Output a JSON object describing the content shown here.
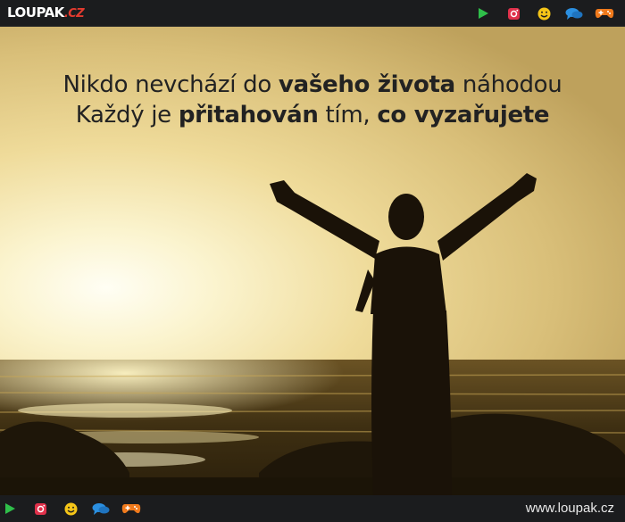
{
  "header": {
    "logo": {
      "main": "LOUPAK",
      "suffix": ".CZ"
    }
  },
  "nav_icons": [
    {
      "name": "play-icon",
      "color": "#2fbf4a"
    },
    {
      "name": "instagram-icon",
      "color": "#e0314b"
    },
    {
      "name": "smiley-icon",
      "color": "#f5c518"
    },
    {
      "name": "chat-icon",
      "color": "#2b8fe0"
    },
    {
      "name": "gamepad-icon",
      "color": "#f07a1c"
    }
  ],
  "quote": {
    "line1": {
      "a": "Nikdo nevchází do ",
      "b": "vašeho života",
      "c": " náhodou"
    },
    "line2": {
      "a": "Každý je ",
      "b": "přitahován",
      "c": " tím, ",
      "d": "co vyzařujete"
    }
  },
  "footer": {
    "site": "www.loupak.cz"
  }
}
